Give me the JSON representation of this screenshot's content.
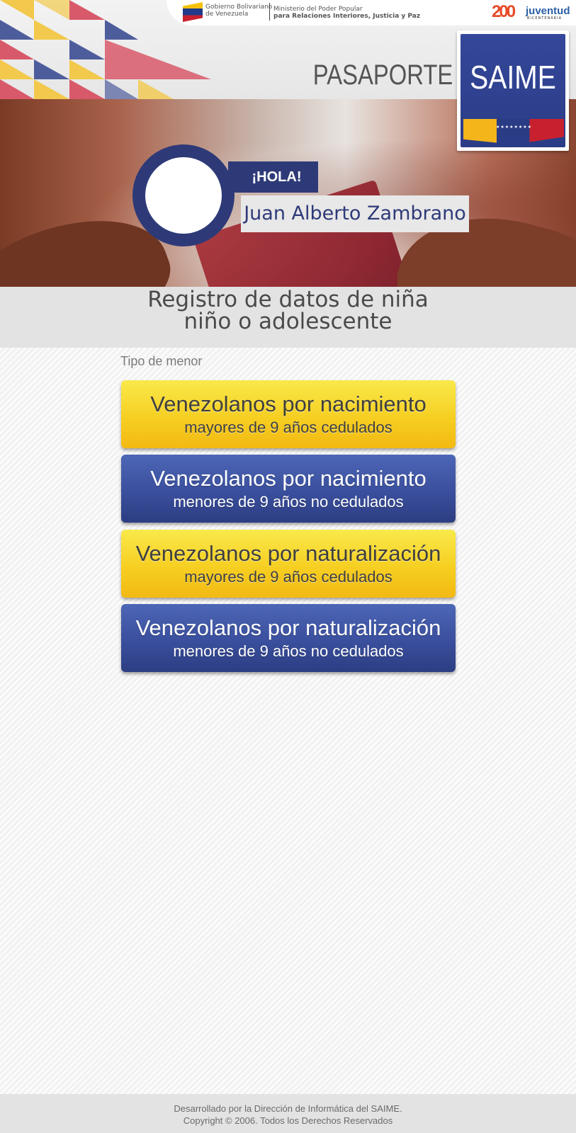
{
  "header": {
    "gov_line1": "Gobierno Bolivariano",
    "gov_line2": "de Venezuela",
    "ministry_line1": "Ministerio del Poder Popular",
    "ministry_line2": "para Relaciones Interiores, Justicia y Paz",
    "juventud_number": "200",
    "juventud_word": "juventud",
    "juventud_sub": "BICENTENARIA",
    "section_word": "PASAPORTE",
    "brand": "SAIME",
    "brand_stars": "★★★★★★★★"
  },
  "greeting": {
    "hello": "¡HOLA!",
    "user_name": "Juan Alberto Zambrano"
  },
  "page": {
    "title_line1": "Registro de datos de niña",
    "title_line2": "niño o adolescente",
    "field_label": "Tipo de menor"
  },
  "options": [
    {
      "title": "Venezolanos por nacimiento",
      "subtitle": "mayores de 9 años cedulados",
      "color": "#f6cf22"
    },
    {
      "title": "Venezolanos por nacimiento",
      "subtitle": "menores de 9 años no cedulados",
      "color": "#3a4f9d"
    },
    {
      "title": "Venezolanos por naturalización",
      "subtitle": "mayores de 9 años cedulados",
      "color": "#f6cf22"
    },
    {
      "title": "Venezolanos por naturalización",
      "subtitle": "menores de 9 años no cedulados",
      "color": "#3a4f9d"
    }
  ],
  "footer": {
    "line1": "Desarrollado por la Dirección de Informática del SAIME.",
    "line2": "Copyright © 2006. Todos los Derechos Reservados"
  },
  "colors": {
    "brand_blue": "#2e3a78",
    "yellow": "#f6cf22",
    "red": "#c8202f"
  }
}
